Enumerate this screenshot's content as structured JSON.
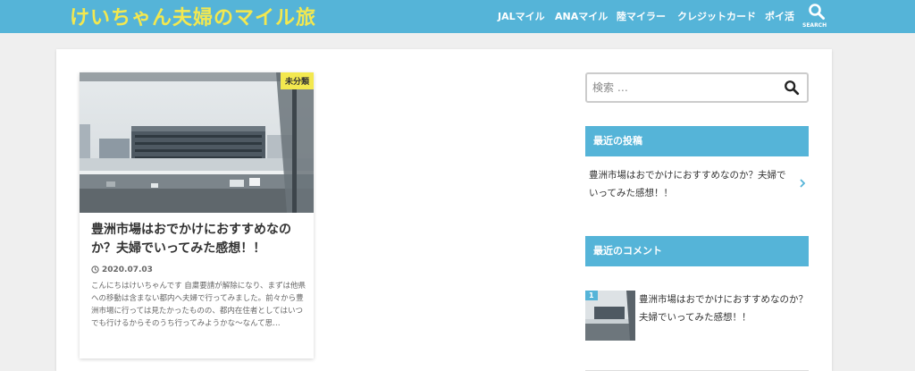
{
  "header": {
    "site_title": "けいちゃん夫婦のマイル旅",
    "nav": [
      "JALマイル",
      "ANAマイル",
      "陸マイラー",
      "クレジットカード",
      "ポイ活"
    ],
    "search_label": "SEARCH"
  },
  "post": {
    "category": "未分類",
    "title": "豊洲市場はおでかけにおすすめなのか？夫婦でいってみた感想！！",
    "date": "2020.07.03",
    "excerpt": "こんにちはけいちゃんです 自粛要請が解除になり、まずは他県への移動は含まない都内へ夫婦で行ってみました。前々から豊洲市場に行っては見たかったものの、都内在住者としてはいつでも行けるからそのうち行ってみようかな～なんて思…"
  },
  "sidebar": {
    "search_placeholder": "検索 …",
    "recent_posts_title": "最近の投稿",
    "recent_posts": [
      {
        "title": "豊洲市場はおでかけにおすすめなのか？夫婦でいってみた感想！！"
      }
    ],
    "recent_comments_title": "最近のコメント",
    "recent_comments": [
      {
        "count": "1",
        "title": "豊洲市場はおでかけにおすすめなのか？夫婦でいってみた感想！！"
      }
    ]
  },
  "colors": {
    "header_bg": "#55b4d8",
    "title_yellow": "#f3e84f",
    "page_bg": "#efefef"
  }
}
